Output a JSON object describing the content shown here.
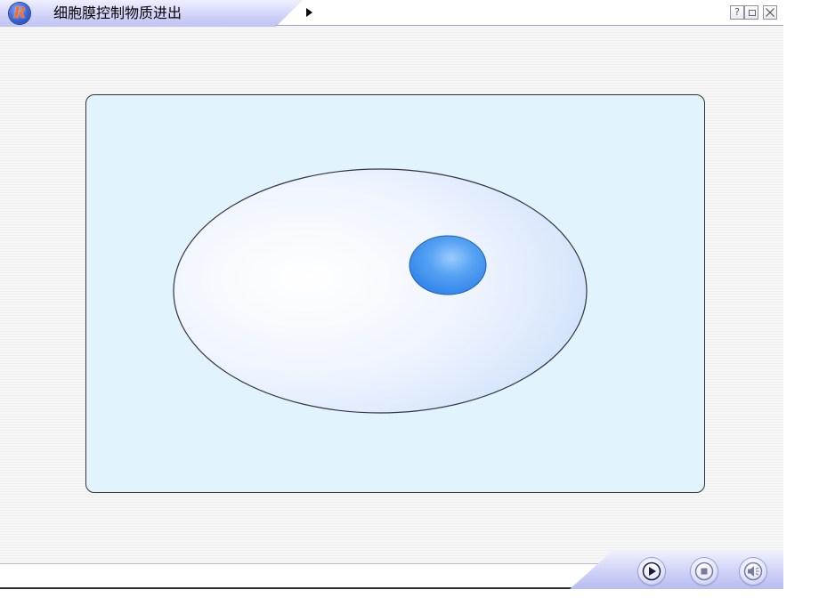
{
  "window": {
    "title": "细胞膜控制物质进出",
    "logo_letter": "R",
    "help_label": "?",
    "controls": [
      "menu-arrow-icon",
      "help-icon",
      "restore-icon",
      "close-icon"
    ]
  },
  "stage": {
    "panel_color": "#e1f4fd",
    "cell_colors": {
      "cytoplasm_center": "#ffffff",
      "cytoplasm_edge": "#cfe0fa",
      "nucleus": "#2f84ea",
      "nucleus_highlight": "#9cccff",
      "membrane": "#333344"
    }
  },
  "controlbar": {
    "status_text": "",
    "buttons": [
      "play-icon",
      "stop-icon",
      "sound-icon"
    ],
    "accent": "#b8bcf0"
  }
}
